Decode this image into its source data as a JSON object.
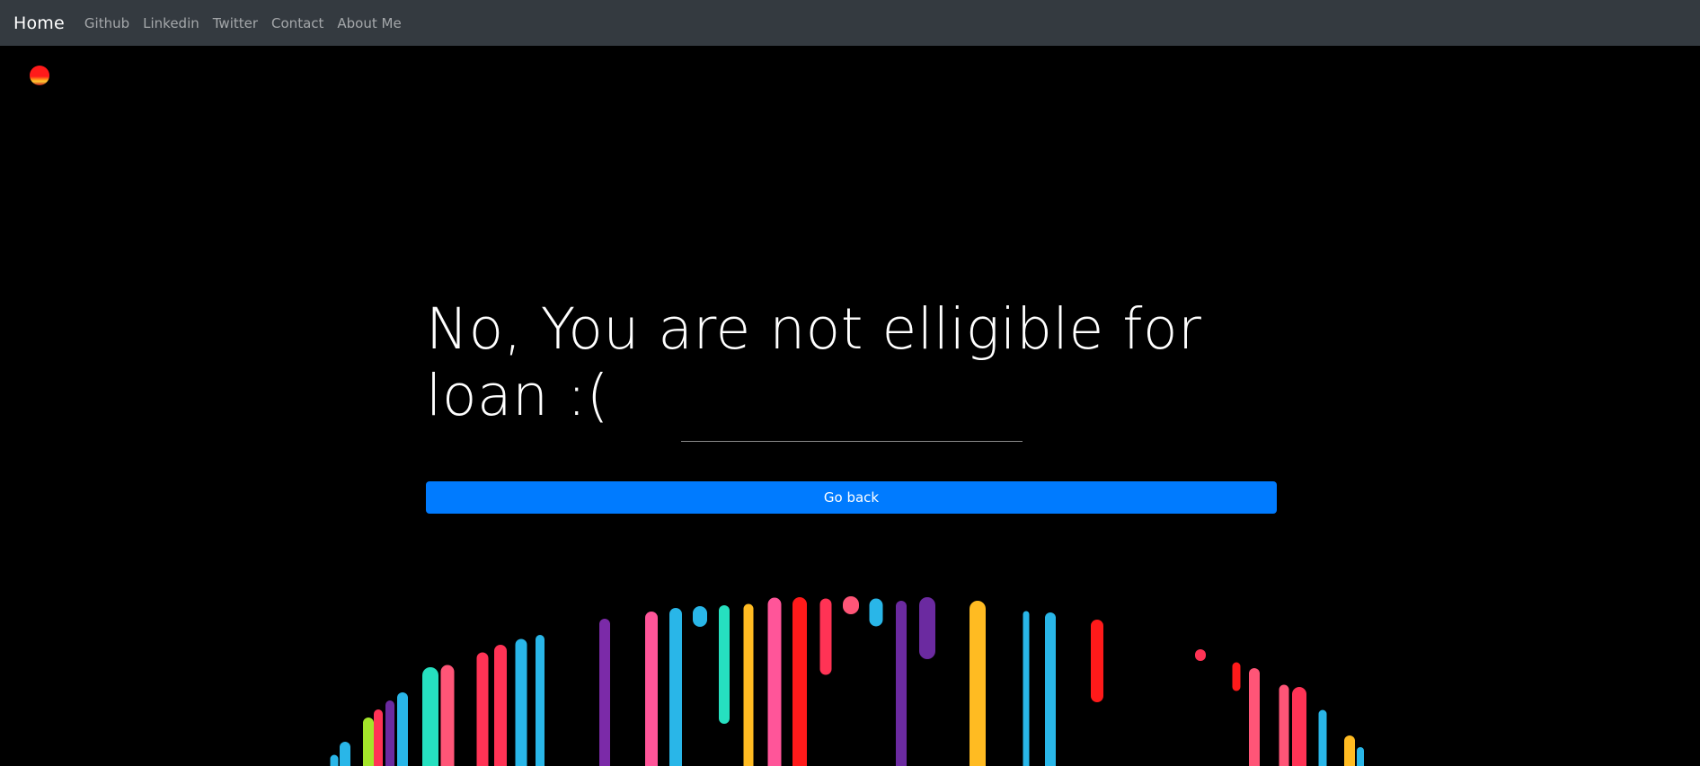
{
  "navbar": {
    "brand": "Home",
    "links": [
      "Github",
      "Linkedin",
      "Twitter",
      "Contact",
      "About Me"
    ]
  },
  "main": {
    "title": "No, You are not elligible for loan :(",
    "back_button": "Go back"
  },
  "colors": {
    "navbar_bg": "#343a40",
    "page_bg": "#000000",
    "button_bg": "#007bff"
  }
}
